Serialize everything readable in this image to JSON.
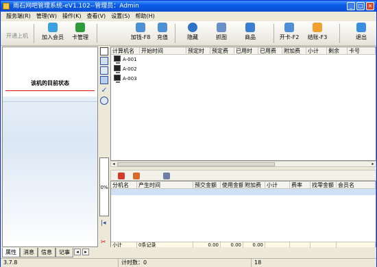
{
  "window": {
    "title": "雨石网吧管理系统-eV1.102--管理员：Admin",
    "buttons": [
      "_",
      "□",
      "×"
    ]
  },
  "menu": [
    "服务端(R)",
    "管理(W)",
    "操作(K)",
    "查看(V)",
    "设置(S)",
    "帮助(H)"
  ],
  "toolbar": {
    "open_machine": "开通上机",
    "add_member": "加入会员",
    "card_manage": "卡管理",
    "add_fee": "加钱-F8",
    "recharge": "充值",
    "hide": "隐藏",
    "screenshot": "抓图",
    "goods": "商品",
    "open_card": "开卡-F2",
    "checkout": "结账-F3",
    "exit": "退出"
  },
  "left_panel": {
    "header": "该机的目前状态",
    "tabs": [
      "属性",
      "消息",
      "信息",
      "记事"
    ],
    "progress_label": "0%"
  },
  "machines_table": {
    "columns": [
      "计算机名",
      "开始时间",
      "预定时",
      "预定费",
      "已用时",
      "已用费",
      "附加费",
      "小计",
      "剩余",
      "卡号"
    ],
    "rows": [
      {
        "name": "A-001"
      },
      {
        "name": "A-002"
      },
      {
        "name": "A-003"
      }
    ]
  },
  "records_table": {
    "columns": [
      "分机名",
      "产生时间",
      "预交金额",
      "使用金额",
      "附加费",
      "小计",
      "费率",
      "找零金额",
      "会员名"
    ],
    "summary": {
      "label": "小计",
      "records": "0条记录",
      "prepay": "0.00",
      "used": "0.00",
      "extra": "0.00"
    }
  },
  "status": {
    "version": "3.7.8",
    "timer": "计时数：0",
    "count": "18"
  },
  "colors": {
    "title_bar": "#0a5be6",
    "accent_red": "#d00000",
    "selection": "#cfe0f7"
  }
}
